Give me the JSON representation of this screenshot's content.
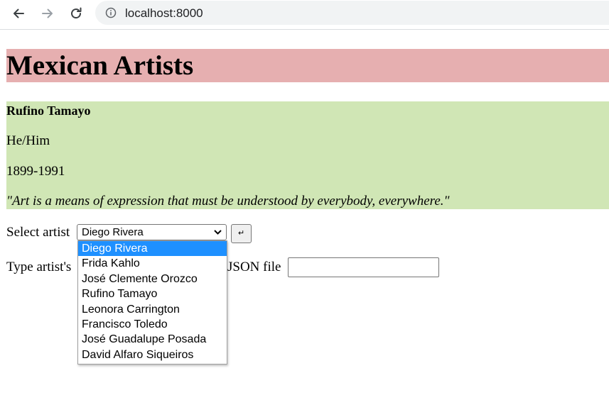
{
  "browser": {
    "url": "localhost:8000"
  },
  "page": {
    "title": "Mexican Artists"
  },
  "artist": {
    "name": "Rufino Tamayo",
    "pronouns": "He/Him",
    "years": "1899-1991",
    "quote": "\"Art is a means of expression that must be understood by everybody, everywhere.\""
  },
  "form": {
    "select_label": "Select artist",
    "selected_value": "Diego Rivera",
    "submit_glyph": "↵",
    "type_label_start": "Type artist's",
    "type_label_end": "JSON file",
    "json_input_value": "",
    "options": [
      "Diego Rivera",
      "Frida Kahlo",
      "José Clemente Orozco",
      "Rufino Tamayo",
      "Leonora Carrington",
      "Francisco Toledo",
      "José Guadalupe Posada",
      "David Alfaro Siqueiros"
    ],
    "highlighted_option_index": 0
  },
  "colors": {
    "title_bg": "#e6afb0",
    "card_bg": "#d0e6b5",
    "option_highlight": "#1e90ff"
  }
}
